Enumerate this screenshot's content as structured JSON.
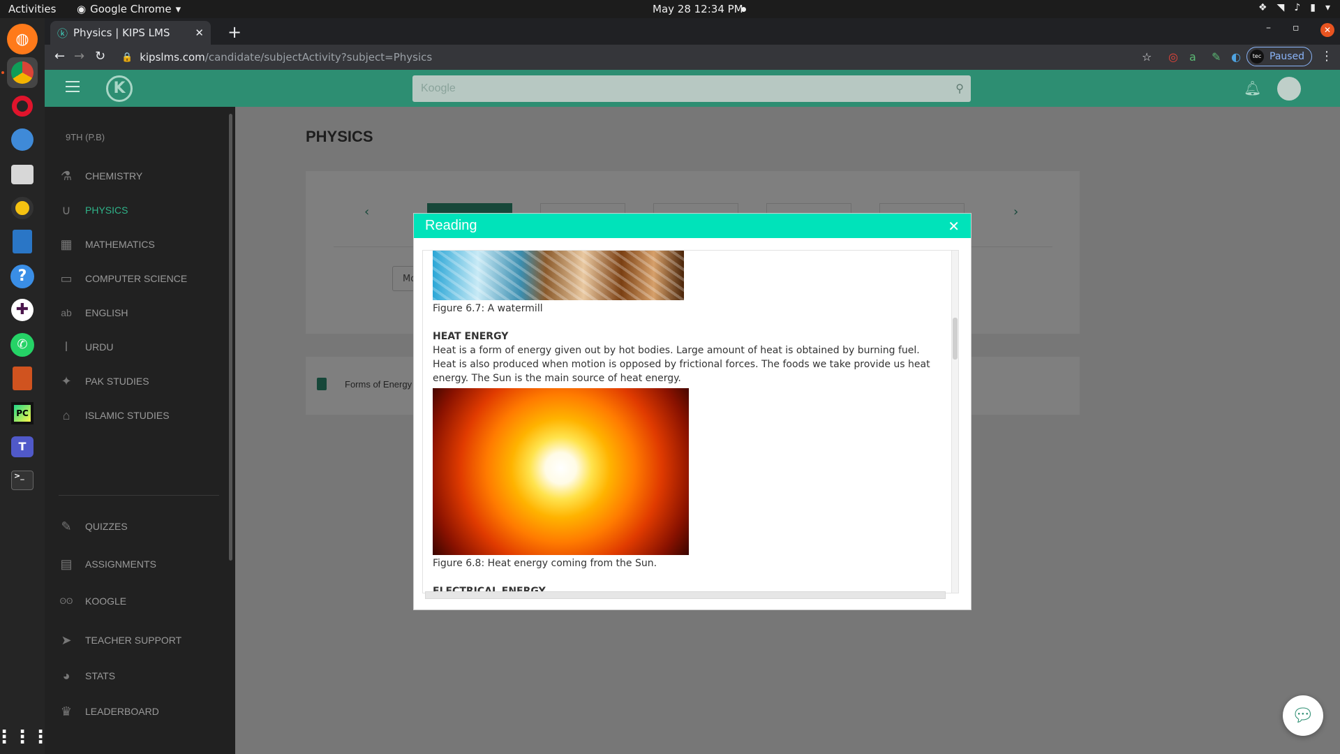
{
  "system": {
    "activities": "Activities",
    "app_name": "Google Chrome",
    "clock": "May 28  12:34 PM"
  },
  "browser": {
    "tab_title": "Physics | KIPS LMS",
    "url_host": "kipslms.com",
    "url_path": "/candidate/subjectActivity?subject=Physics",
    "profile_status": "Paused",
    "profile_avatar": "tec"
  },
  "header": {
    "search_placeholder": "Koogle",
    "logo_letter": "K"
  },
  "sidebar": {
    "class_label": "9TH (P.B)",
    "subjects": [
      {
        "label": "CHEMISTRY",
        "icon": "flask-icon"
      },
      {
        "label": "PHYSICS",
        "icon": "magnet-icon",
        "active": true
      },
      {
        "label": "MATHEMATICS",
        "icon": "calculator-icon"
      },
      {
        "label": "COMPUTER SCIENCE",
        "icon": "monitor-icon"
      },
      {
        "label": "ENGLISH",
        "icon": "abc-icon"
      },
      {
        "label": "URDU",
        "icon": "urdu-script-icon"
      },
      {
        "label": "PAK STUDIES",
        "icon": "falcon-icon"
      },
      {
        "label": "ISLAMIC STUDIES",
        "icon": "mosque-icon"
      }
    ],
    "tools": [
      {
        "label": "QUIZZES",
        "icon": "edit-icon"
      },
      {
        "label": "ASSIGNMENTS",
        "icon": "clipboard-icon"
      },
      {
        "label": "KOOGLE",
        "icon": "owl-icon"
      },
      {
        "label": "TEACHER SUPPORT",
        "icon": "paper-plane-icon"
      },
      {
        "label": "STATS",
        "icon": "pie-chart-icon"
      },
      {
        "label": "LEADERBOARD",
        "icon": "trophy-icon"
      }
    ]
  },
  "main": {
    "title": "PHYSICS",
    "button_partial": "Mo",
    "resource_label": "Forms of Energy"
  },
  "modal": {
    "title": "Reading",
    "fig67_caption": "Figure 6.7: A watermill",
    "heat_heading": "HEAT ENERGY",
    "heat_text": "Heat is a form of energy given out by hot bodies. Large amount of heat is obtained by burning fuel. Heat is also produced when motion is opposed by frictional forces. The foods we take provide us heat energy. The Sun is the main source of heat energy.",
    "fig68_caption": "Figure 6.8: Heat energy coming from the Sun.",
    "elec_heading": "ELECTRICAL ENERGY"
  },
  "colors": {
    "brand_green": "#2d8e72",
    "modal_accent": "#00e3ba",
    "sidebar_bg": "#212121"
  }
}
